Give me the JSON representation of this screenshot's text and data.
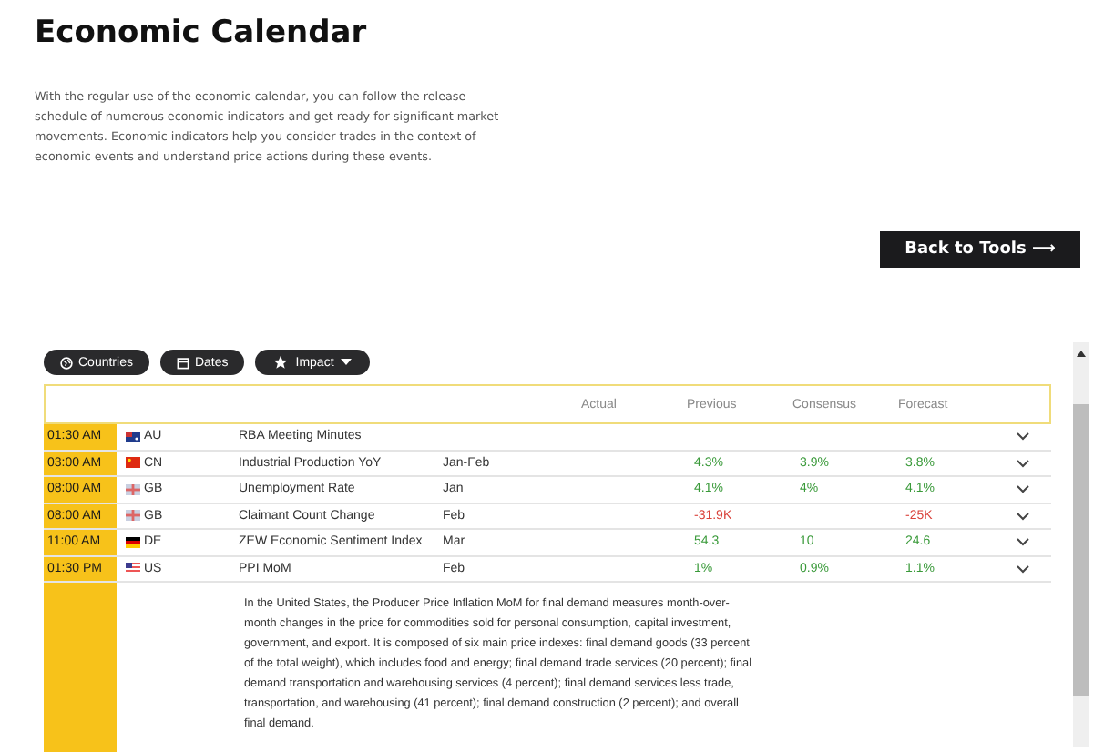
{
  "title": "Economic Calendar",
  "intro": "With the regular use of the economic calendar, you can follow the release schedule of numerous economic indicators and get ready for significant market movements. Economic indicators help you consider trades in the context of economic events and understand price actions during these events.",
  "back_button": "Back to Tools ⟶",
  "filters": [
    {
      "label": "Countries",
      "kind": "globe"
    },
    {
      "label": "Dates",
      "kind": "calendar"
    },
    {
      "label": "Impact",
      "kind": "star"
    }
  ],
  "columns": [
    "Actual",
    "Previous",
    "Consensus",
    "Forecast"
  ],
  "rows": [
    {
      "time": "01:30 AM",
      "kind": "au",
      "country": "AU",
      "event": "RBA Meeting Minutes"
    },
    {
      "time": "03:00 AM",
      "kind": "cn",
      "country": "CN",
      "event": "Industrial Production YoY",
      "period": "Jan-Feb",
      "previous": {
        "text": "4.3%",
        "color": "#3a9a3a"
      },
      "consensus": {
        "text": "3.9%",
        "color": "#3a9a3a"
      },
      "forecast": {
        "text": "3.8%",
        "color": "#3a9a3a"
      }
    },
    {
      "time": "08:00 AM",
      "kind": "gb",
      "country": "GB",
      "event": "Unemployment Rate",
      "period": "Jan",
      "previous": {
        "text": "4.1%",
        "color": "#3a9a3a"
      },
      "consensus": {
        "text": "4%",
        "color": "#3a9a3a"
      },
      "forecast": {
        "text": "4.1%",
        "color": "#3a9a3a"
      }
    },
    {
      "time": "08:00 AM",
      "kind": "gb",
      "country": "GB",
      "event": "Claimant Count Change",
      "period": "Feb",
      "previous": {
        "text": "-31.9K",
        "color": "#d9423a"
      },
      "forecast": {
        "text": "-25K",
        "color": "#d9423a"
      }
    },
    {
      "time": "11:00 AM",
      "kind": "de",
      "country": "DE",
      "event": "ZEW Economic Sentiment Index",
      "period": "Mar",
      "previous": {
        "text": "54.3",
        "color": "#3a9a3a"
      },
      "consensus": {
        "text": "10",
        "color": "#3a9a3a"
      },
      "forecast": {
        "text": "24.6",
        "color": "#3a9a3a"
      }
    },
    {
      "time": "01:30 PM",
      "kind": "us",
      "country": "US",
      "event": "PPI MoM",
      "period": "Feb",
      "previous": {
        "text": "1%",
        "color": "#3a9a3a"
      },
      "consensus": {
        "text": "0.9%",
        "color": "#3a9a3a"
      },
      "forecast": {
        "text": "1.1%",
        "color": "#3a9a3a"
      },
      "description": "In the United States, the Producer Price Inflation MoM for final demand measures month-over-month changes in the price for commodities sold for personal consumption, capital investment, government, and export. It is composed of six main price indexes: final demand goods (33 percent of the total weight), which includes food and energy; final demand trade services (20 percent); final demand transportation and warehousing services (4 percent); final demand services less trade, transportation, and warehousing (41 percent); final demand construction (2 percent); and overall final demand."
    }
  ]
}
